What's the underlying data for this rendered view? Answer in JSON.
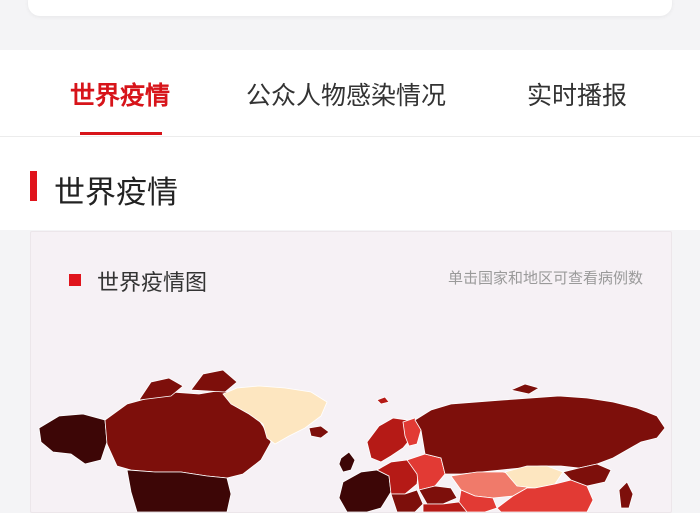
{
  "tabs": [
    {
      "label": "世界疫情",
      "active": true
    },
    {
      "label": "公众人物感染情况",
      "active": false
    },
    {
      "label": "实时播报",
      "active": false
    }
  ],
  "section": {
    "title": "世界疫情"
  },
  "map": {
    "title": "世界疫情图",
    "hint": "单击国家和地区可查看病例数",
    "colors": {
      "darkest": "#3d0606",
      "dark": "#7d0f0b",
      "mid": "#b51a16",
      "bright": "#e23a34",
      "light": "#f07a6a",
      "pale": "#fde6c0"
    }
  },
  "colors": {
    "accent": "#d7141a"
  }
}
